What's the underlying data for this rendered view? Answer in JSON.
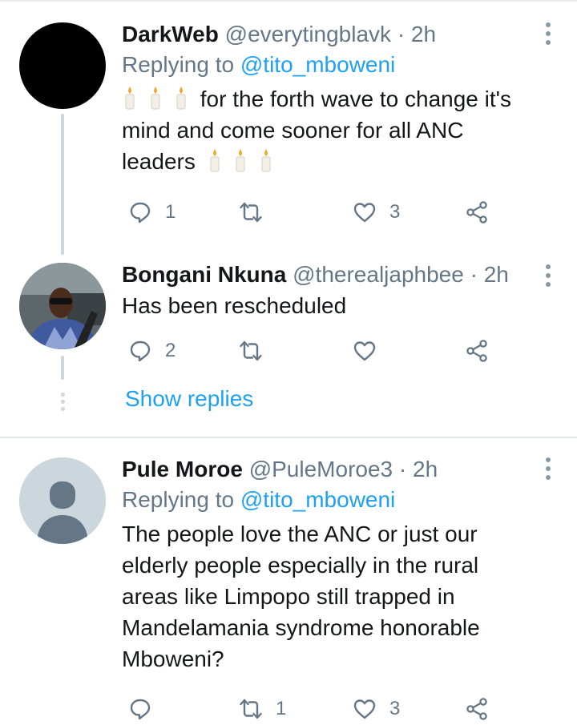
{
  "tweets": [
    {
      "name": "DarkWeb",
      "handle": "@everytingblavk",
      "time": "· 2h",
      "replying_prefix": "Replying to",
      "replying_handle": "@tito_mboweni",
      "body_line1": "for the forth wave to change it's",
      "body_line2": "mind and come sooner for all ANC",
      "body_line3": "leaders",
      "reply_count": "1",
      "retweet_count": "",
      "like_count": "3"
    },
    {
      "name": "Bongani Nkuna",
      "handle": "@therealjaphbee",
      "time": "· 2h",
      "body": "Has been rescheduled",
      "reply_count": "2",
      "retweet_count": "",
      "like_count": ""
    },
    {
      "name": "Pule Moroe",
      "handle": "@PuleMoroe3",
      "time": "· 2h",
      "replying_prefix": "Replying to",
      "replying_handle": "@tito_mboweni",
      "body_lines": [
        "The people love  the ANC or just  our",
        "elderly people especially in the rural",
        "areas like Limpopo still trapped in",
        "Mandelamania syndrome  honorable",
        "Mboweni?"
      ],
      "reply_count": "",
      "retweet_count": "1",
      "like_count": "3"
    }
  ],
  "show_replies_label": "Show replies",
  "icons": {
    "reply": "reply-icon",
    "retweet": "retweet-icon",
    "like": "heart-icon",
    "share": "share-icon",
    "more": "more-vertical-icon",
    "candle": "candle-emoji"
  },
  "colors": {
    "link": "#1da1f2",
    "secondary_text": "#657786",
    "icon": "#657786",
    "thread_line": "#ccd6dd"
  }
}
